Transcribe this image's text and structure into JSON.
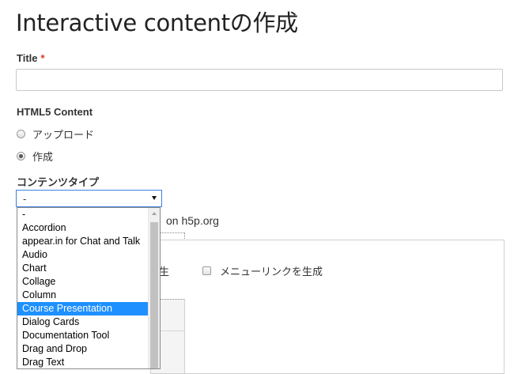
{
  "page": {
    "title": "Interactive contentの作成"
  },
  "form": {
    "title_label": "Title",
    "title_required_mark": "*",
    "title_value": "",
    "html5_label": "HTML5 Content",
    "radio_upload": "アップロード",
    "radio_create": "作成",
    "content_type_label": "コンテンツタイプ",
    "selected_value": "-"
  },
  "behind": {
    "h5p_text": "on h5p.org",
    "partial_text": "生",
    "menu_link_label": "メニューリンクを生成"
  },
  "dropdown": {
    "options": [
      "-",
      "Accordion",
      "appear.in for Chat and Talk",
      "Audio",
      "Chart",
      "Collage",
      "Column",
      "Course Presentation",
      "Dialog Cards",
      "Documentation Tool",
      "Drag and Drop",
      "Drag Text"
    ],
    "highlighted": "Course Presentation"
  },
  "colors": {
    "required": "#e0302a",
    "highlight": "#1e90ff",
    "focus_border": "#3d80e0"
  }
}
